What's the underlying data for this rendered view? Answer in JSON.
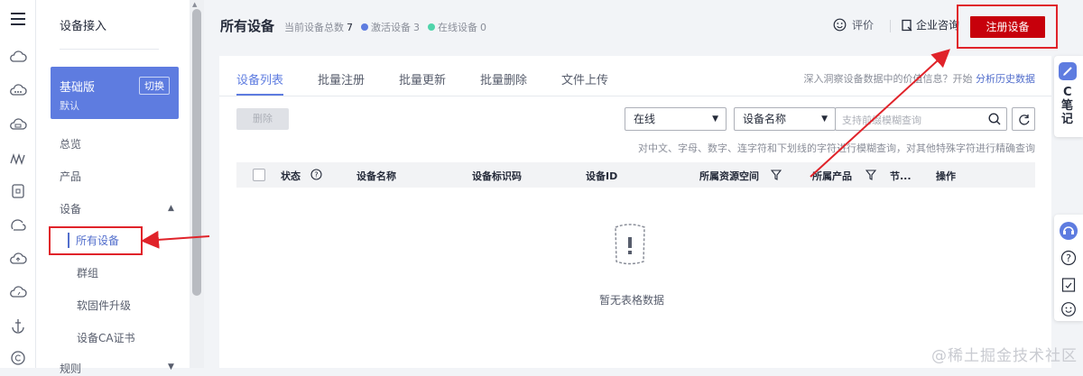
{
  "sidebar": {
    "title": "设备接入",
    "edition": {
      "name": "基础版",
      "sub": "默认",
      "switch_label": "切换"
    },
    "nav": [
      {
        "label": "总览"
      },
      {
        "label": "产品"
      },
      {
        "label": "设备",
        "expanded": true
      }
    ],
    "sub_nav": [
      {
        "label": "所有设备",
        "active": true
      },
      {
        "label": "群组"
      },
      {
        "label": "软固件升级"
      },
      {
        "label": "设备CA证书"
      }
    ],
    "next_section": "规则"
  },
  "header": {
    "title": "所有设备",
    "total_label": "当前设备总数",
    "total_value": "7",
    "active_label": "激活设备",
    "active_value": "3",
    "online_label": "在线设备",
    "online_value": "0",
    "rate_label": "评价",
    "consult_label": "企业咨询",
    "register_label": "注册设备"
  },
  "tabs": [
    {
      "label": "设备列表",
      "active": true
    },
    {
      "label": "批量注册"
    },
    {
      "label": "批量更新"
    },
    {
      "label": "批量删除"
    },
    {
      "label": "文件上传"
    }
  ],
  "insight": {
    "text": "深入洞察设备数据中的价值信息？开始",
    "link": "分析历史数据"
  },
  "toolbar": {
    "delete_label": "删除",
    "status_select": "在线",
    "field_select": "设备名称",
    "search_placeholder": "支持前缀模糊查询",
    "hint": "对中文、字母、数字、连字符和下划线的字符进行模糊查询，对其他特殊字符进行精确查询"
  },
  "table": {
    "columns": [
      "状态",
      "设备名称",
      "设备标识码",
      "设备ID",
      "所属资源空间",
      "所属产品",
      "节...",
      "操作"
    ],
    "empty_text": "暂无表格数据"
  },
  "note_widget": {
    "c": "C",
    "label": "笔记"
  },
  "watermark": "@稀土掘金技术社区",
  "colors": {
    "accent": "#5e7ce0",
    "primary_button": "#c7000b",
    "highlight": "#e0232a",
    "active_dot": "#5e7ce0",
    "online_dot": "#50d4ab"
  }
}
